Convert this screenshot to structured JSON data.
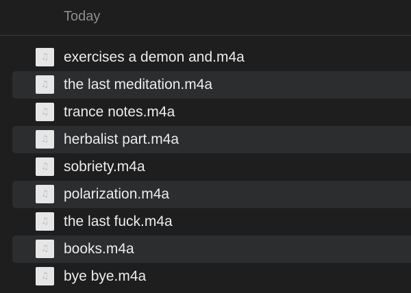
{
  "section": {
    "title": "Today"
  },
  "files": [
    {
      "name": "exercises a demon and.m4a",
      "icon": "audio-file-icon"
    },
    {
      "name": "the last meditation.m4a",
      "icon": "audio-file-icon"
    },
    {
      "name": "trance notes.m4a",
      "icon": "audio-file-icon"
    },
    {
      "name": "herbalist part.m4a",
      "icon": "audio-file-icon"
    },
    {
      "name": "sobriety.m4a",
      "icon": "audio-file-icon"
    },
    {
      "name": "polarization.m4a",
      "icon": "audio-file-icon"
    },
    {
      "name": "the last fuck.m4a",
      "icon": "audio-file-icon"
    },
    {
      "name": "books.m4a",
      "icon": "audio-file-icon"
    },
    {
      "name": "bye bye.m4a",
      "icon": "audio-file-icon"
    }
  ],
  "colors": {
    "background": "#1e1e1e",
    "alt_row": "#2b2d2f",
    "header_text": "#8e8e8e",
    "file_text": "#ececec",
    "icon_bg": "#e6e6e6"
  }
}
